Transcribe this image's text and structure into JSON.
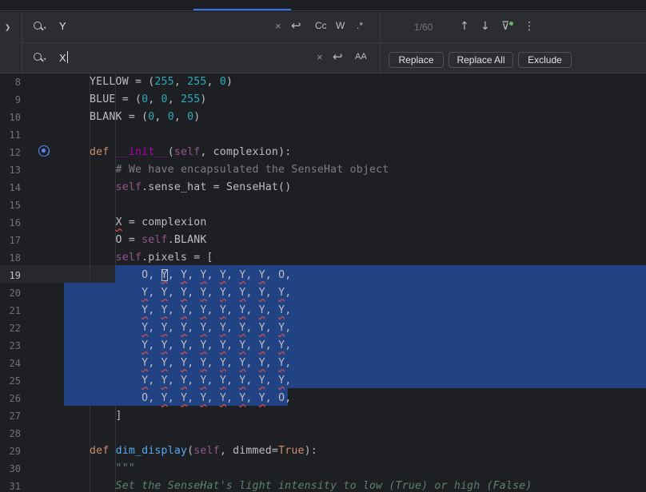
{
  "find": {
    "value": "Y"
  },
  "replace": {
    "value": "X"
  },
  "options": {
    "clear": "×",
    "wrap": "↩",
    "match_case": "Cc",
    "words": "W",
    "regex": ".*",
    "preserve_case": "AA"
  },
  "match_count": "1/60",
  "nav": {
    "prev": "↑",
    "next": "↓",
    "filter": "⊽",
    "more": "⋮"
  },
  "buttons": {
    "replace": "Replace",
    "replace_all": "Replace All",
    "exclude": "Exclude"
  },
  "icons": [
    "search-icon",
    "chevron-down-icon",
    "clear-icon",
    "newline-icon",
    "arrow-up-icon",
    "arrow-down-icon",
    "filter-icon",
    "more-icon",
    "override-gutter-icon"
  ],
  "colors": {
    "selection": "#214283",
    "keyword": "#cf8e6d",
    "number": "#2aacb8",
    "accent": "#3574f0"
  },
  "editor": {
    "lines": [
      {
        "n": "8",
        "text": "YELLOW = (255, 255, 0)"
      },
      {
        "n": "9",
        "text": "BLUE = (0, 0, 255)"
      },
      {
        "n": "10",
        "text": "BLANK = (0, 0, 0)"
      },
      {
        "n": "11",
        "text": ""
      },
      {
        "n": "12",
        "text": "def __init__(self, complexion):"
      },
      {
        "n": "13",
        "text": "    # We have encapsulated the SenseHat object"
      },
      {
        "n": "14",
        "text": "    self.sense_hat = SenseHat()"
      },
      {
        "n": "15",
        "text": ""
      },
      {
        "n": "16",
        "text": "    X = complexion"
      },
      {
        "n": "17",
        "text": "    O = self.BLANK"
      },
      {
        "n": "18",
        "text": "    self.pixels = ["
      },
      {
        "n": "19",
        "text": "        O, Y, Y, Y, Y, Y, Y, O,"
      },
      {
        "n": "20",
        "text": "        Y, Y, Y, Y, Y, Y, Y, Y,"
      },
      {
        "n": "21",
        "text": "        Y, Y, Y, Y, Y, Y, Y, Y,"
      },
      {
        "n": "22",
        "text": "        Y, Y, Y, Y, Y, Y, Y, Y,"
      },
      {
        "n": "23",
        "text": "        Y, Y, Y, Y, Y, Y, Y, Y,"
      },
      {
        "n": "24",
        "text": "        Y, Y, Y, Y, Y, Y, Y, Y,"
      },
      {
        "n": "25",
        "text": "        Y, Y, Y, Y, Y, Y, Y, Y,"
      },
      {
        "n": "26",
        "text": "        O, Y, Y, Y, Y, Y, Y, O,"
      },
      {
        "n": "27",
        "text": "    ]"
      },
      {
        "n": "28",
        "text": ""
      },
      {
        "n": "29",
        "text": "def dim_display(self, dimmed=True):"
      },
      {
        "n": "30",
        "text": "    \"\"\""
      },
      {
        "n": "31",
        "text": "    Set the SenseHat's light intensity to low (True) or high (False)"
      }
    ]
  }
}
